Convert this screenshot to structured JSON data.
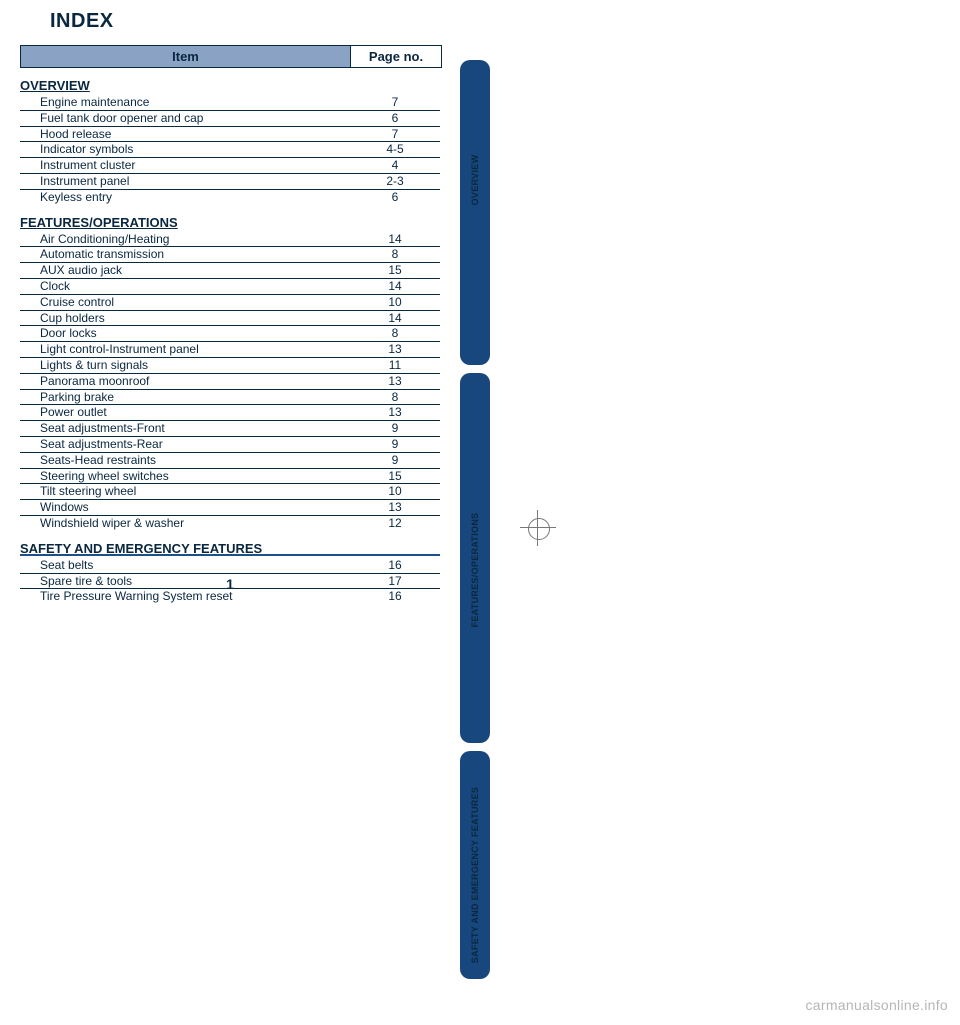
{
  "title": "INDEX",
  "header": {
    "item": "Item",
    "page": "Page no."
  },
  "strip_labels": {
    "l1": "OVERVIEW",
    "l2": "FEATURES/OPERATIONS",
    "l3": "SAFETY AND EMERGENCY FEATURES"
  },
  "sections": [
    {
      "heading": "OVERVIEW",
      "rows": [
        {
          "item": "Engine maintenance",
          "page": "7"
        },
        {
          "item": "Fuel tank door opener and cap",
          "page": "6"
        },
        {
          "item": "Hood release",
          "page": "7"
        },
        {
          "item": "Indicator symbols",
          "page": "4-5"
        },
        {
          "item": "Instrument cluster",
          "page": "4"
        },
        {
          "item": "Instrument panel",
          "page": "2-3"
        },
        {
          "item": "Keyless entry",
          "page": "6"
        }
      ]
    },
    {
      "heading": "FEATURES/OPERATIONS",
      "rows": [
        {
          "item": "Air Conditioning/Heating",
          "page": "14"
        },
        {
          "item": "Automatic transmission",
          "page": "8"
        },
        {
          "item": "AUX audio jack",
          "page": "15"
        },
        {
          "item": "Clock",
          "page": "14"
        },
        {
          "item": "Cruise control",
          "page": "10"
        },
        {
          "item": "Cup holders",
          "page": "14"
        },
        {
          "item": "Door locks",
          "page": "8"
        },
        {
          "item": "Light control-Instrument panel",
          "page": "13"
        },
        {
          "item": "Lights & turn signals",
          "page": "11"
        },
        {
          "item": "Panorama moonroof",
          "page": "13"
        },
        {
          "item": "Parking brake",
          "page": "8"
        },
        {
          "item": "Power outlet",
          "page": "13"
        },
        {
          "item": "Seat adjustments-Front",
          "page": "9"
        },
        {
          "item": "Seat adjustments-Rear",
          "page": "9"
        },
        {
          "item": "Seats-Head restraints",
          "page": "9"
        },
        {
          "item": "Steering wheel switches",
          "page": "15"
        },
        {
          "item": "Tilt steering wheel",
          "page": "10"
        },
        {
          "item": "Windows",
          "page": "13"
        },
        {
          "item": "Windshield wiper & washer",
          "page": "12"
        }
      ]
    },
    {
      "heading": "SAFETY AND EMERGENCY FEATURES",
      "rows": [
        {
          "item": "Seat belts",
          "page": "16"
        },
        {
          "item": "Spare tire & tools",
          "page": "17"
        },
        {
          "item": "Tire Pressure Warning System reset",
          "page": "16"
        }
      ]
    }
  ],
  "page_number": "1",
  "watermark": "carmanualsonline.info"
}
